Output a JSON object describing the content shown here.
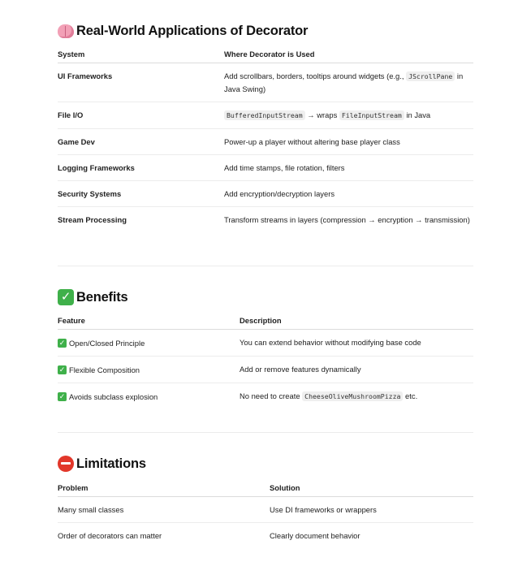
{
  "sections": {
    "applications": {
      "title": "Real-World Applications of Decorator",
      "icon": "brain-icon",
      "headers": [
        "System",
        "Where Decorator is Used"
      ],
      "rows": [
        {
          "system": "UI Frameworks",
          "use_before": "Add scrollbars, borders, tooltips around widgets (e.g., ",
          "use_code": "JScrollPane",
          "use_after": " in Java Swing)"
        },
        {
          "system": "File I/O",
          "use_code1": "BufferedInputStream",
          "use_mid": " → wraps ",
          "use_code2": "FileInputStream",
          "use_after": " in Java"
        },
        {
          "system": "Game Dev",
          "use": "Power-up a player without altering base player class"
        },
        {
          "system": "Logging Frameworks",
          "use": "Add time stamps, file rotation, filters"
        },
        {
          "system": "Security Systems",
          "use": "Add encryption/decryption layers"
        },
        {
          "system": "Stream Processing",
          "use": "Transform streams in layers (compression → encryption → transmission)"
        }
      ]
    },
    "benefits": {
      "title": "Benefits",
      "icon": "check-mark-icon",
      "headers": [
        "Feature",
        "Description"
      ],
      "rows": [
        {
          "feature": "Open/Closed Principle",
          "description": "You can extend behavior without modifying base code"
        },
        {
          "feature": "Flexible Composition",
          "description": "Add or remove features dynamically"
        },
        {
          "feature": "Avoids subclass explosion",
          "description_before": "No need to create ",
          "description_code": "CheeseOliveMushroomPizza",
          "description_after": " etc."
        }
      ]
    },
    "limitations": {
      "title": "Limitations",
      "icon": "stop-sign-icon",
      "headers": [
        "Problem",
        "Solution"
      ],
      "rows": [
        {
          "problem": "Many small classes",
          "solution": "Use DI frameworks or wrappers"
        },
        {
          "problem": "Order of decorators can matter",
          "solution": "Clearly document behavior"
        }
      ]
    }
  }
}
